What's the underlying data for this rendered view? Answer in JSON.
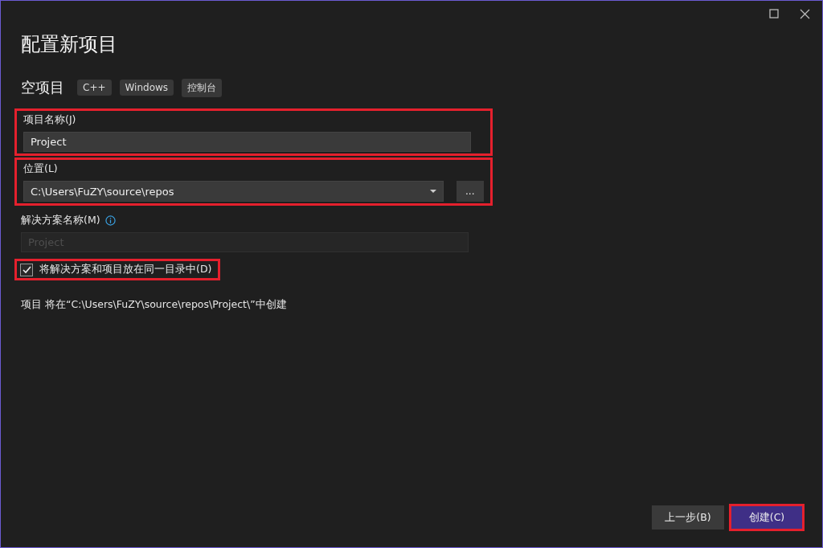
{
  "window": {
    "title": "配置新项目"
  },
  "template": {
    "name": "空项目",
    "tags": [
      "C++",
      "Windows",
      "控制台"
    ]
  },
  "project_name": {
    "label": "项目名称(J)",
    "value": "Project",
    "highlighted": true
  },
  "location": {
    "label": "位置(L)",
    "value": "C:\\Users\\FuZY\\source\\repos",
    "browse": "...",
    "highlighted": true
  },
  "solution_name": {
    "label": "解决方案名称(M)",
    "placeholder": "Project",
    "disabled": true
  },
  "same_directory": {
    "label": "将解决方案和项目放在同一目录中(D)",
    "checked": true,
    "highlighted": true
  },
  "summary": "项目 将在“C:\\Users\\FuZY\\source\\repos\\Project\\”中创建",
  "buttons": [
    {
      "label": "上一步(B)",
      "kind": "secondary",
      "highlighted": false
    },
    {
      "label": "创建(C)",
      "kind": "primary",
      "highlighted": true
    }
  ]
}
